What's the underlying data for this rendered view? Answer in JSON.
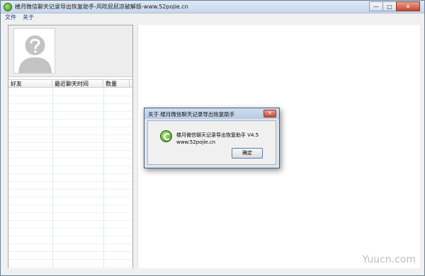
{
  "window": {
    "title": "楼月微信聊天记录导出恢复助手-风吹屁屁凉破解版-www.52pojie.cn",
    "controls": {
      "minimize": "—",
      "maximize": "□",
      "close": "✕"
    }
  },
  "menu": {
    "items": [
      "文件",
      "关于"
    ]
  },
  "table": {
    "columns": [
      "好友",
      "最近聊天时间",
      "数量"
    ]
  },
  "dialog": {
    "title": "关于 楼月微信聊天记录导出恢复助手",
    "close": "✕",
    "line1": "楼月微信聊天记录导出恢复助手 V4.5",
    "line2": "www.52pojie.cn",
    "ok": "确定"
  },
  "watermark": "Yuucn.com",
  "icons": [
    "app-icon",
    "avatar-placeholder-icon",
    "dialog-app-icon"
  ]
}
